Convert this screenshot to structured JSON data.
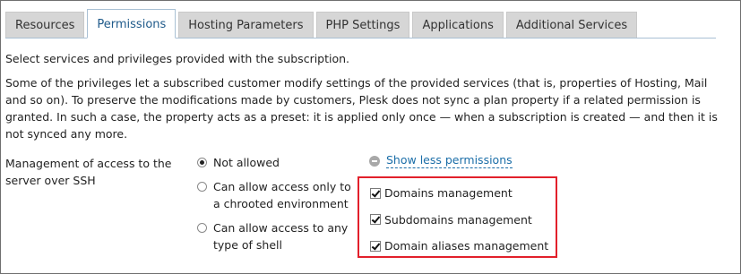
{
  "tabs": [
    {
      "label": "Resources",
      "active": false
    },
    {
      "label": "Permissions",
      "active": true
    },
    {
      "label": "Hosting Parameters",
      "active": false
    },
    {
      "label": "PHP Settings",
      "active": false
    },
    {
      "label": "Applications",
      "active": false
    },
    {
      "label": "Additional Services",
      "active": false
    }
  ],
  "intro": "Select services and privileges provided with the subscription.",
  "notes": "Some of the privileges let a subscribed customer modify settings of the provided services (that is, properties of Hosting, Mail and so on). To preserve the modifications made by customers, Plesk does not sync a plan property if a related permission is granted. In such a case, the property acts as a preset: it is applied only once — when a subscription is created — and then it is not synced any more.",
  "ssh": {
    "label": "Management of access to the server over SSH",
    "options": [
      {
        "label": "Not allowed",
        "checked": true
      },
      {
        "label": "Can allow access only to a chrooted environment",
        "checked": false
      },
      {
        "label": "Can allow access to any type of shell",
        "checked": false
      }
    ]
  },
  "show_less": "Show less permissions",
  "permissions": [
    {
      "label": "Domains management",
      "checked": true
    },
    {
      "label": "Subdomains management",
      "checked": true
    },
    {
      "label": "Domain aliases management",
      "checked": true
    }
  ],
  "colors": {
    "highlight_border": "#e2202b",
    "link": "#1b6ea8",
    "active_tab": "#1f5a8a"
  }
}
